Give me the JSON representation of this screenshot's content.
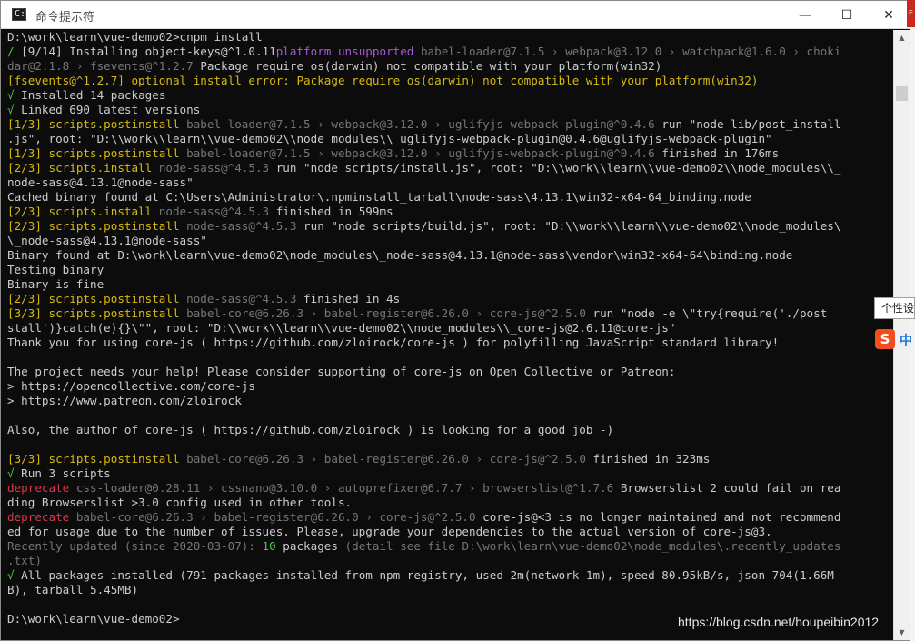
{
  "window": {
    "title": "命令提示符",
    "icon": "cmd-icon",
    "icon_glyph": "C:\\",
    "minimize_glyph": "—",
    "maximize_glyph": "☐",
    "close_glyph": "✕"
  },
  "console_lines": [
    [
      [
        "w",
        "D:\\work\\learn\\vue-demo02>cnpm install"
      ]
    ],
    [
      [
        "g",
        "/ "
      ],
      [
        "w",
        "[9/14] Installing object-keys@^1.0.11"
      ],
      [
        "m",
        "platform unsupported "
      ],
      [
        "gr",
        "babel-loader@7.1.5 › webpack@3.12.0 › watchpack@1.6.0 › choki"
      ]
    ],
    [
      [
        "gr",
        "dar@2.1.8 › fsevents@^1.2.7 "
      ],
      [
        "w",
        "Package require os(darwin) not compatible with your platform(win32)"
      ]
    ],
    [
      [
        "y",
        "[fsevents@^1.2.7] optional install error: Package require os(darwin) not compatible with your platform(win32)"
      ]
    ],
    [
      [
        "g",
        "√ "
      ],
      [
        "w",
        "Installed 14 packages"
      ]
    ],
    [
      [
        "g",
        "√ "
      ],
      [
        "w",
        "Linked 690 latest versions"
      ]
    ],
    [
      [
        "y",
        "[1/3] scripts.postinstall "
      ],
      [
        "gr",
        "babel-loader@7.1.5 › webpack@3.12.0 › uglifyjs-webpack-plugin@^0.4.6 "
      ],
      [
        "w",
        "run \"node lib/post_install"
      ]
    ],
    [
      [
        "w",
        ".js\", root: \"D:\\\\work\\\\learn\\\\vue-demo02\\\\node_modules\\\\_uglifyjs-webpack-plugin@0.4.6@uglifyjs-webpack-plugin\""
      ]
    ],
    [
      [
        "y",
        "[1/3] scripts.postinstall "
      ],
      [
        "gr",
        "babel-loader@7.1.5 › webpack@3.12.0 › uglifyjs-webpack-plugin@^0.4.6 "
      ],
      [
        "w",
        "finished in 176ms"
      ]
    ],
    [
      [
        "y",
        "[2/3] scripts.install "
      ],
      [
        "gr",
        "node-sass@^4.5.3 "
      ],
      [
        "w",
        "run \"node scripts/install.js\", root: \"D:\\\\work\\\\learn\\\\vue-demo02\\\\node_modules\\\\_"
      ]
    ],
    [
      [
        "w",
        "node-sass@4.13.1@node-sass\""
      ]
    ],
    [
      [
        "w",
        "Cached binary found at C:\\Users\\Administrator\\.npminstall_tarball\\node-sass\\4.13.1\\win32-x64-64_binding.node"
      ]
    ],
    [
      [
        "y",
        "[2/3] scripts.install "
      ],
      [
        "gr",
        "node-sass@^4.5.3 "
      ],
      [
        "w",
        "finished in 599ms"
      ]
    ],
    [
      [
        "y",
        "[2/3] scripts.postinstall "
      ],
      [
        "gr",
        "node-sass@^4.5.3 "
      ],
      [
        "w",
        "run \"node scripts/build.js\", root: \"D:\\\\work\\\\learn\\\\vue-demo02\\\\node_modules\\"
      ]
    ],
    [
      [
        "w",
        "\\_node-sass@4.13.1@node-sass\""
      ]
    ],
    [
      [
        "w",
        "Binary found at D:\\work\\learn\\vue-demo02\\node_modules\\_node-sass@4.13.1@node-sass\\vendor\\win32-x64-64\\binding.node"
      ]
    ],
    [
      [
        "w",
        "Testing binary"
      ]
    ],
    [
      [
        "w",
        "Binary is fine"
      ]
    ],
    [
      [
        "y",
        "[2/3] scripts.postinstall "
      ],
      [
        "gr",
        "node-sass@^4.5.3 "
      ],
      [
        "w",
        "finished in 4s"
      ]
    ],
    [
      [
        "y",
        "[3/3] scripts.postinstall "
      ],
      [
        "gr",
        "babel-core@6.26.3 › babel-register@6.26.0 › core-js@^2.5.0 "
      ],
      [
        "w",
        "run \"node -e \\\"try{require('./post"
      ]
    ],
    [
      [
        "w",
        "stall')}catch(e){}\\\"\", root: \"D:\\\\work\\\\learn\\\\vue-demo02\\\\node_modules\\\\_core-js@2.6.11@core-js\""
      ]
    ],
    [
      [
        "w",
        "Thank you for using core-js ( https://github.com/zloirock/core-js ) for polyfilling JavaScript standard library!"
      ]
    ],
    [
      [
        "w",
        ""
      ]
    ],
    [
      [
        "w",
        "The project needs your help! Please consider supporting of core-js on Open Collective or Patreon:"
      ]
    ],
    [
      [
        "w",
        "> https://opencollective.com/core-js"
      ]
    ],
    [
      [
        "w",
        "> https://www.patreon.com/zloirock"
      ]
    ],
    [
      [
        "w",
        ""
      ]
    ],
    [
      [
        "w",
        "Also, the author of core-js ( https://github.com/zloirock ) is looking for a good job -)"
      ]
    ],
    [
      [
        "w",
        ""
      ]
    ],
    [
      [
        "y",
        "[3/3] scripts.postinstall "
      ],
      [
        "gr",
        "babel-core@6.26.3 › babel-register@6.26.0 › core-js@^2.5.0 "
      ],
      [
        "w",
        "finished in 323ms"
      ]
    ],
    [
      [
        "g",
        "√ "
      ],
      [
        "w",
        "Run 3 scripts"
      ]
    ],
    [
      [
        "r",
        "deprecate "
      ],
      [
        "gr",
        "css-loader@0.28.11 › cssnano@3.10.0 › autoprefixer@6.7.7 › browserslist@^1.7.6 "
      ],
      [
        "w",
        "Browserslist 2 could fail on rea"
      ]
    ],
    [
      [
        "w",
        "ding Browserslist >3.0 config used in other tools."
      ]
    ],
    [
      [
        "r",
        "deprecate "
      ],
      [
        "gr",
        "babel-core@6.26.3 › babel-register@6.26.0 › core-js@^2.5.0 "
      ],
      [
        "w",
        "core-js@<3 is no longer maintained and not recommend"
      ]
    ],
    [
      [
        "w",
        "ed for usage due to the number of issues. Please, upgrade your dependencies to the actual version of core-js@3."
      ]
    ],
    [
      [
        "gr",
        "Recently updated (since 2020-03-07): "
      ],
      [
        "g",
        "10 "
      ],
      [
        "w",
        "packages "
      ],
      [
        "gr",
        "(detail see file D:\\work\\learn\\vue-demo02\\node_modules\\.recently_updates"
      ]
    ],
    [
      [
        "gr",
        ".txt)"
      ]
    ],
    [
      [
        "g",
        "√ "
      ],
      [
        "w",
        "All packages installed (791 packages installed from npm registry, used 2m(network 1m), speed 80.95kB/s, json 704(1.66M"
      ]
    ],
    [
      [
        "w",
        "B), tarball 5.45MB)"
      ]
    ],
    [
      [
        "w",
        ""
      ]
    ],
    [
      [
        "w",
        "D:\\work\\learn\\vue-demo02>"
      ]
    ]
  ],
  "scrollbar": {
    "up_arrow": "▲",
    "down_arrow": "▼"
  },
  "tooltip": {
    "text": "个性设"
  },
  "ime": {
    "logo": "S",
    "text": "中"
  },
  "watermark": "https://blog.csdn.net/houpeibin2012",
  "side_badge": "E",
  "colors": {
    "console_bg": "#0c0c0c",
    "text_default": "#cccccc",
    "text_green": "#4ec943",
    "text_yellow": "#d7b90f",
    "text_gray": "#767676",
    "text_magenta": "#a75ad0",
    "text_red": "#d5394a"
  }
}
